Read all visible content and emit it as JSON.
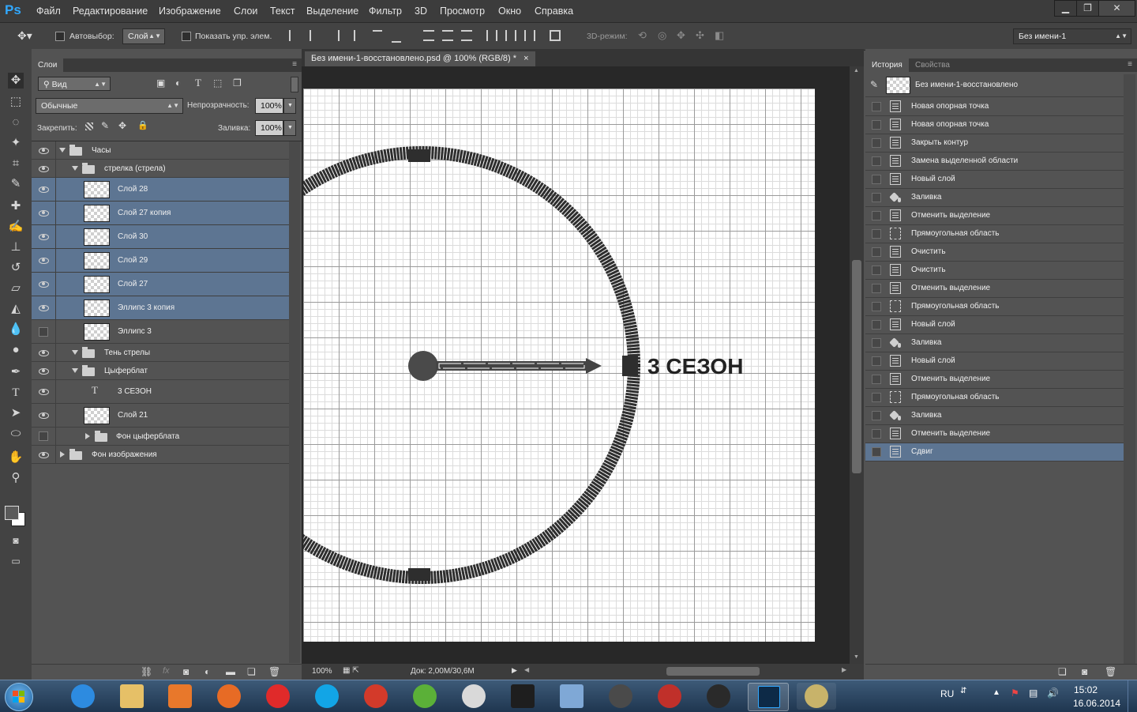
{
  "app": {
    "logo": "Ps"
  },
  "menu": [
    "Файл",
    "Редактирование",
    "Изображение",
    "Слои",
    "Текст",
    "Выделение",
    "Фильтр",
    "3D",
    "Просмотр",
    "Окно",
    "Справка"
  ],
  "window_controls": {
    "minimize": "▁",
    "restore": "❐",
    "close": "✕"
  },
  "options": {
    "autoselect_label": "Автовыбор:",
    "autoselect_value": "Слой",
    "show_transform": "Показать упр. элем.",
    "mode3d_label": "3D-режим:",
    "workspace": "Без имени-1"
  },
  "layers_panel": {
    "tab": "Слои",
    "filter": "Вид",
    "blend_mode": "Обычные",
    "opacity_label": "Непрозрачность:",
    "opacity": "100%",
    "lock_label": "Закрепить:",
    "fill_label": "Заливка:",
    "fill": "100%",
    "layers": [
      {
        "name": "Часы"
      },
      {
        "name": "стрелка (стрела)"
      },
      {
        "name": "Слой 28"
      },
      {
        "name": "Слой 27 копия"
      },
      {
        "name": "Слой 30"
      },
      {
        "name": "Слой 29"
      },
      {
        "name": "Слой 27"
      },
      {
        "name": "Эллипс 3 копия"
      },
      {
        "name": "Эллипс 3"
      },
      {
        "name": "Тень стрелы"
      },
      {
        "name": "Цыферблат"
      },
      {
        "name": "3 СЕЗОН"
      },
      {
        "name": "Слой 21"
      },
      {
        "name": "Фон цыферблата"
      },
      {
        "name": "Фон изображения"
      }
    ]
  },
  "document": {
    "tab_title": "Без имени-1-восстановлено.psd @ 100% (RGB/8) *",
    "tab_close": "×",
    "canvas_text": "3 СЕЗОН",
    "zoom": "100%",
    "doc_info": "Док: 2,00M/30,6M"
  },
  "history_panel": {
    "tabs": [
      "История",
      "Свойства"
    ],
    "snapshot": "Без имени-1-восстановлено",
    "items": [
      "Новая опорная точка",
      "Новая опорная точка",
      "Закрыть контур",
      "Замена выделенной области",
      "Новый слой",
      "Заливка",
      "Отменить выделение",
      "Прямоугольная область",
      "Очистить",
      "Очистить",
      "Отменить выделение",
      "Прямоугольная область",
      "Новый слой",
      "Заливка",
      "Новый слой",
      "Отменить выделение",
      "Прямоугольная область",
      "Заливка",
      "Отменить выделение",
      "Сдвиг"
    ]
  },
  "taskbar": {
    "lang": "RU",
    "time": "15:02",
    "date": "16.06.2014"
  }
}
